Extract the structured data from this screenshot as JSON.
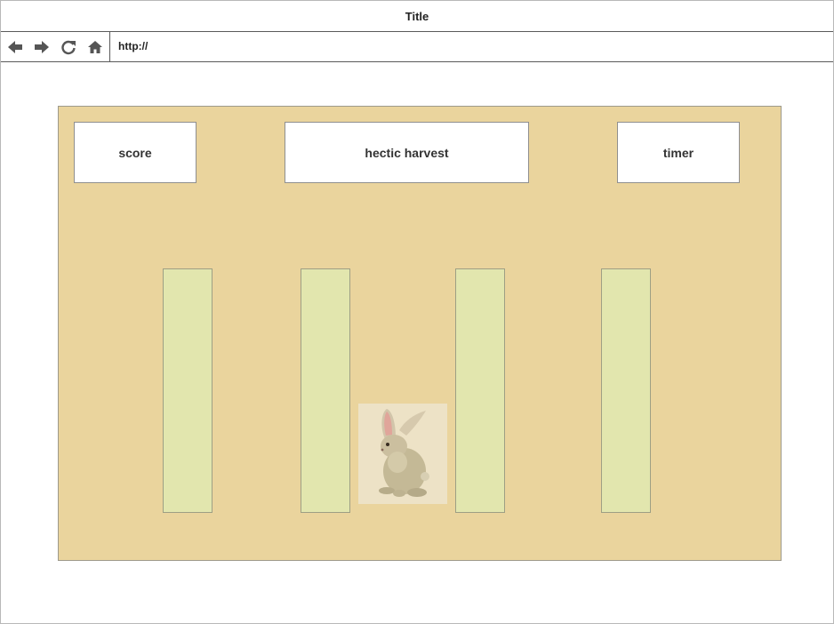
{
  "window": {
    "title": "Title"
  },
  "navbar": {
    "url": "http://",
    "buttons": {
      "back": "arrow-left-icon",
      "forward": "arrow-right-icon",
      "refresh": "refresh-icon",
      "home": "home-icon"
    }
  },
  "game": {
    "background_color": "#ead49d",
    "score_label": "score",
    "title": "hectic harvest",
    "timer_label": "timer",
    "plots": [
      "plot",
      "plot",
      "plot",
      "plot"
    ],
    "plot_color": "#e2e6ae",
    "character": "rabbit"
  }
}
